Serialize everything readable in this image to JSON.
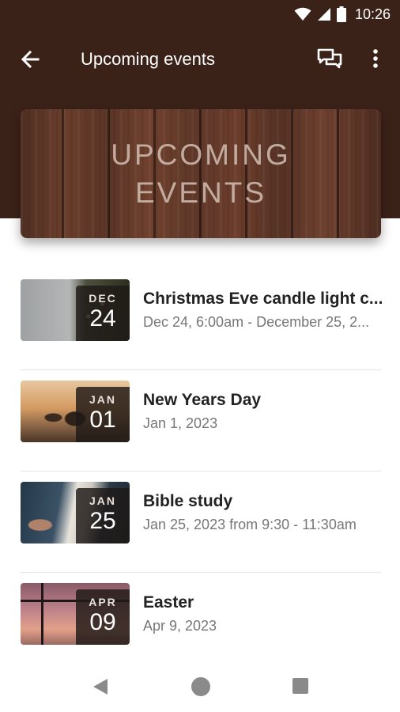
{
  "status_bar": {
    "time": "10:26"
  },
  "app_bar": {
    "title": "Upcoming events"
  },
  "banner": {
    "line1": "UPCOMING",
    "line2": "EVENTS"
  },
  "events": [
    {
      "month": "DEC",
      "day": "24",
      "title": "Christmas Eve candle light c...",
      "date": "Dec 24, 6:00am - December 25, 2..."
    },
    {
      "month": "JAN",
      "day": "01",
      "title": "New Years Day",
      "date": "Jan 1, 2023"
    },
    {
      "month": "JAN",
      "day": "25",
      "title": "Bible study",
      "date": "Jan 25, 2023 from 9:30 - 11:30am"
    },
    {
      "month": "APR",
      "day": "09",
      "title": "Easter",
      "date": "Apr 9, 2023"
    }
  ],
  "colors": {
    "header_brown": "#3b2219",
    "text_primary": "#222222",
    "text_secondary": "#777777"
  }
}
